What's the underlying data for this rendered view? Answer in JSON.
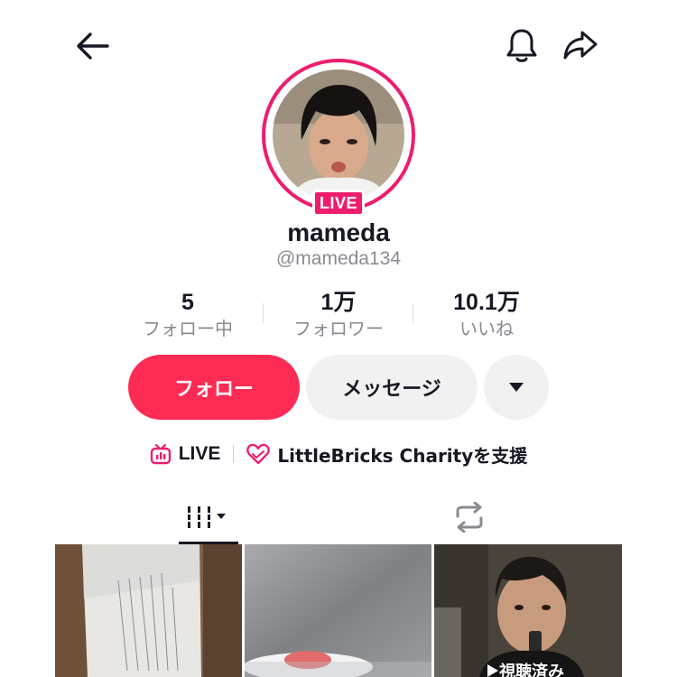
{
  "header": {
    "back_icon": "arrow-left-icon",
    "bell_icon": "bell-icon",
    "share_icon": "share-arrow-icon"
  },
  "profile": {
    "live_badge": "LIVE",
    "username": "mameda",
    "handle": "@mameda134",
    "ring_color": "#ee1d6e"
  },
  "stats": [
    {
      "value": "5",
      "label": "フォロー中"
    },
    {
      "value": "1万",
      "label": "フォロワー"
    },
    {
      "value": "10.1万",
      "label": "いいね"
    }
  ],
  "actions": {
    "follow_label": "フォロー",
    "message_label": "メッセージ",
    "more_icon": "caret-down-icon",
    "follow_color": "#fe2c55"
  },
  "links": {
    "live_label": "LIVE",
    "charity_label": "LittleBricks Charityを支援"
  },
  "tabs": {
    "videos_icon": "grid-bars-icon",
    "repost_icon": "repost-icon"
  },
  "videos": [
    {
      "thumb": "document-on-wall"
    },
    {
      "thumb": "plate-food-frosted-glass"
    },
    {
      "thumb": "person-eating",
      "badge": "視聴済み"
    }
  ]
}
